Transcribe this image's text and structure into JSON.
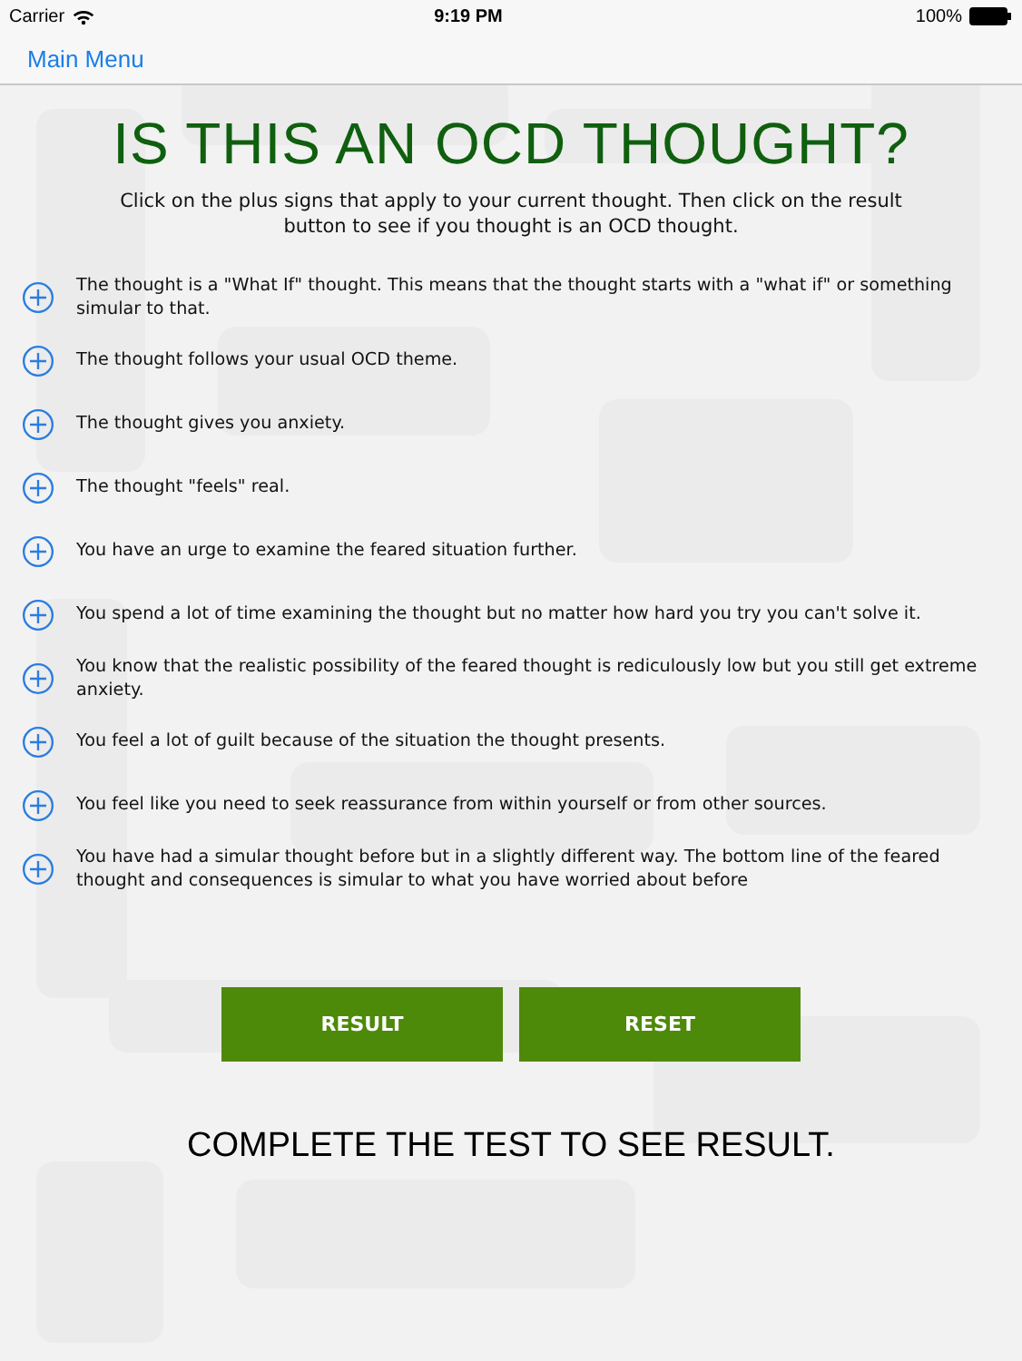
{
  "status_bar": {
    "carrier": "Carrier",
    "time": "9:19 PM",
    "battery": "100%"
  },
  "nav": {
    "back": "Main Menu"
  },
  "title": "IS THIS AN OCD THOUGHT?",
  "instructions": "Click on the plus signs that apply to your current thought. Then click on the result button to see if you thought is an OCD thought.",
  "items": [
    {
      "text": "The thought is a \"What If\" thought. This means that the thought starts with a \"what if\" or something simular to that."
    },
    {
      "text": "The thought follows your usual OCD theme."
    },
    {
      "text": "The thought gives you anxiety."
    },
    {
      "text": "The thought \"feels\" real."
    },
    {
      "text": "You have an urge to examine the feared situation further."
    },
    {
      "text": "You spend a lot of time examining the thought but no matter how hard you try you can't solve it."
    },
    {
      "text": "You know that the realistic possibility of the feared thought is rediculously low but you still get extreme anxiety."
    },
    {
      "text": "You feel a lot of guilt because of the situation the thought presents."
    },
    {
      "text": "You feel like you need to seek reassurance from within yourself or from other sources."
    },
    {
      "text": "You have had a simular thought before but in a slightly different way. The bottom line of the feared thought and consequences is simular to what you have worried about before"
    }
  ],
  "buttons": [
    "RESULT",
    "RESET"
  ],
  "result": "COMPLETE THE TEST TO SEE RESULT."
}
